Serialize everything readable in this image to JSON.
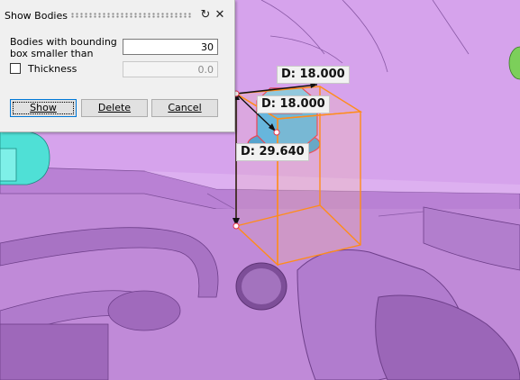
{
  "dialog": {
    "title": "Show Bodies",
    "bodies_label": "Bodies with bounding box smaller than",
    "bodies_value": "30",
    "thickness_label": "Thickness",
    "thickness_checked": false,
    "thickness_value": "0.0",
    "buttons": {
      "show": "Show",
      "delete": "Delete",
      "cancel": "Cancel"
    },
    "icons": {
      "reset": "refresh-icon",
      "close": "close-icon"
    }
  },
  "dimensions": [
    {
      "label": "D: 18.000"
    },
    {
      "label": "D: 18.000"
    },
    {
      "label": "D: 29.640"
    }
  ],
  "colors": {
    "part": "#c08ad8",
    "part_shadow": "#8e5fae",
    "bbox": "#ff8c1a",
    "nut_face": "#52b4e8",
    "nut_outline": "#e8334a",
    "cyan_part": "#4fe0d6",
    "green_part": "#7ccf5a"
  }
}
